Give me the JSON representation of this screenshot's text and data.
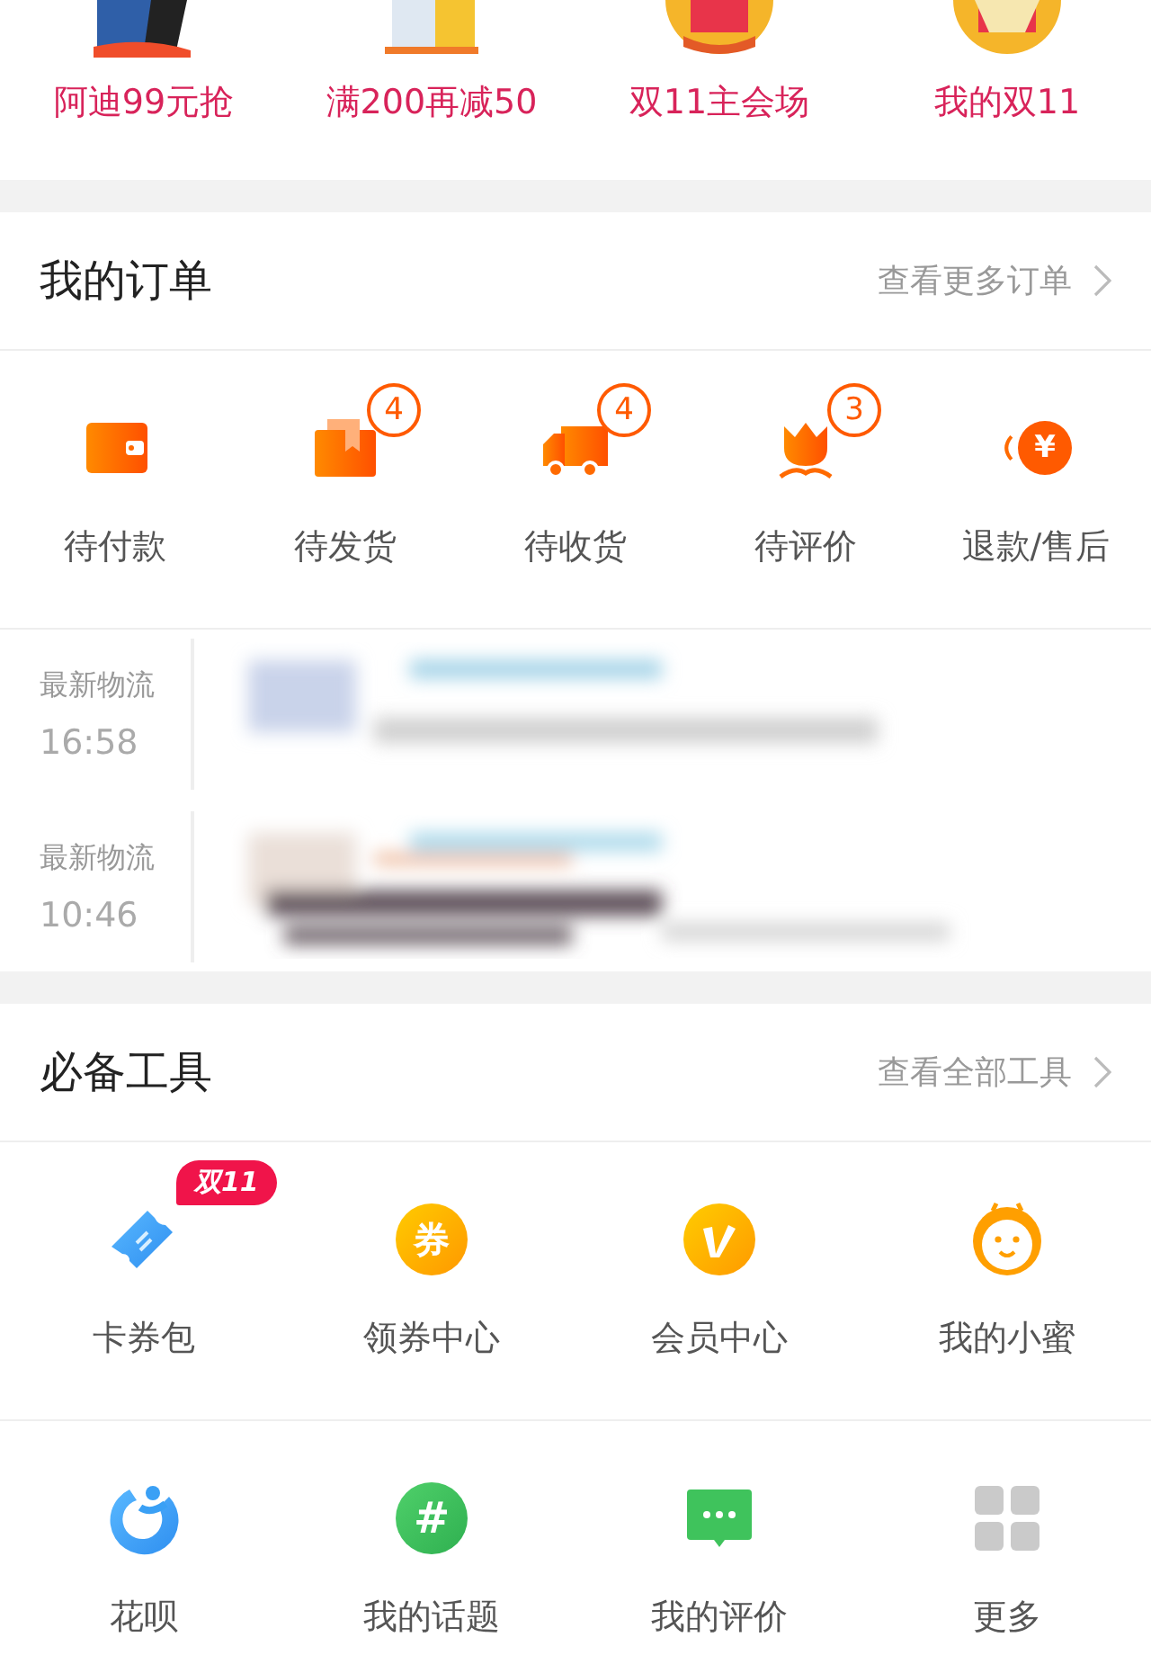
{
  "promos": [
    {
      "label": "阿迪99元抢"
    },
    {
      "label": "满200再减50"
    },
    {
      "label": "双11主会场"
    },
    {
      "label": "我的双11"
    }
  ],
  "orders": {
    "title": "我的订单",
    "more": "查看更多订单",
    "items": [
      {
        "label": "待付款"
      },
      {
        "label": "待发货",
        "badge": "4"
      },
      {
        "label": "待收货",
        "badge": "4"
      },
      {
        "label": "待评价",
        "badge": "3"
      },
      {
        "label": "退款/售后",
        "glyph": "¥"
      }
    ]
  },
  "logistics": [
    {
      "label": "最新物流",
      "time": "16:58"
    },
    {
      "label": "最新物流",
      "time": "10:46"
    }
  ],
  "tools": {
    "title": "必备工具",
    "more": "查看全部工具",
    "rows": [
      [
        {
          "label": "卡券包",
          "tag": "双11"
        },
        {
          "label": "领券中心",
          "glyph": "券"
        },
        {
          "label": "会员中心"
        },
        {
          "label": "我的小蜜"
        }
      ],
      [
        {
          "label": "花呗"
        },
        {
          "label": "我的话题",
          "glyph": "#"
        },
        {
          "label": "我的评价"
        },
        {
          "label": "更多"
        }
      ]
    ]
  }
}
